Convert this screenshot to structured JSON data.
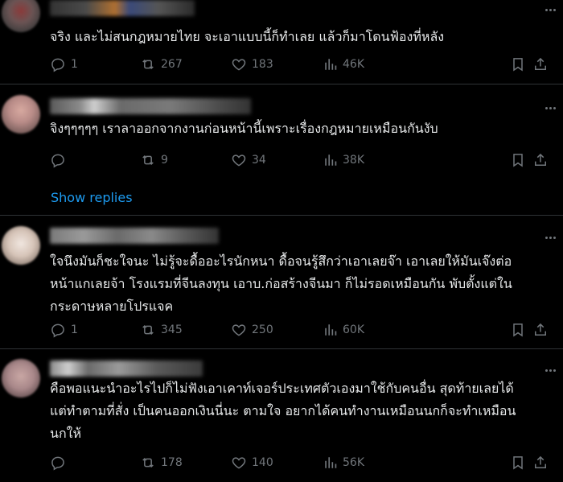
{
  "colors": {
    "background": "#000000",
    "text": "#e7e9ea",
    "muted": "#71767b",
    "link": "#1d9bf0",
    "divider": "#2f3336"
  },
  "icons": {
    "reply": "reply-icon",
    "retweet": "retweet-icon",
    "like": "heart-icon",
    "views": "views-chart-icon",
    "bookmark": "bookmark-icon",
    "share": "share-icon"
  },
  "posts": [
    {
      "text": "จริง และไม่สนกฎหมายไทย จะเอาแบบนี้ก็ทำเลย แล้วก็มาโดนฟ้องที่หลัง",
      "replies": "1",
      "reposts": "267",
      "likes": "183",
      "views": "46K"
    },
    {
      "text": "จิงๆๆๆๆๆ เราลาออกจากงานก่อนหน้านี้เพราะเรื่องกฎหมายเหมือนกันงับ",
      "replies": "",
      "reposts": "9",
      "likes": "34",
      "views": "38K"
    },
    {
      "text": "ใจนึงมันก็ชะใจนะ ไม่รู้จะดื้ออะไรนักหนา ดื้อจนรู้สึกว่าเอาเลยจ๊า เอาเลยให้มันเจ๊งต่อ\nหน้าแกเลยจ้า โรงแรมที่จีนลงทุน เอาบ.ก่อสร้างจีนมา ก็ไม่รอดเหมือนกัน พับตั้งแต่ใน\nกระดาษหลายโปรแจค",
      "replies": "1",
      "reposts": "345",
      "likes": "250",
      "views": "60K"
    },
    {
      "text": "คือพอแนะนำอะไรไปก็ไม่ฟังเอาเคาท์เจอร์ประเทศตัวเองมาใช้กับคนอื่น สุดท้ายเลยได้\nแต่ทำตามที่สั่ง เป็นคนออกเงินนี่นะ ตามใจ อยากได้คนทำงานเหมือนนกก็จะทำเหมือน\nนกให้",
      "replies": "",
      "reposts": "178",
      "likes": "140",
      "views": "56K"
    }
  ],
  "show_replies_label": "Show replies"
}
